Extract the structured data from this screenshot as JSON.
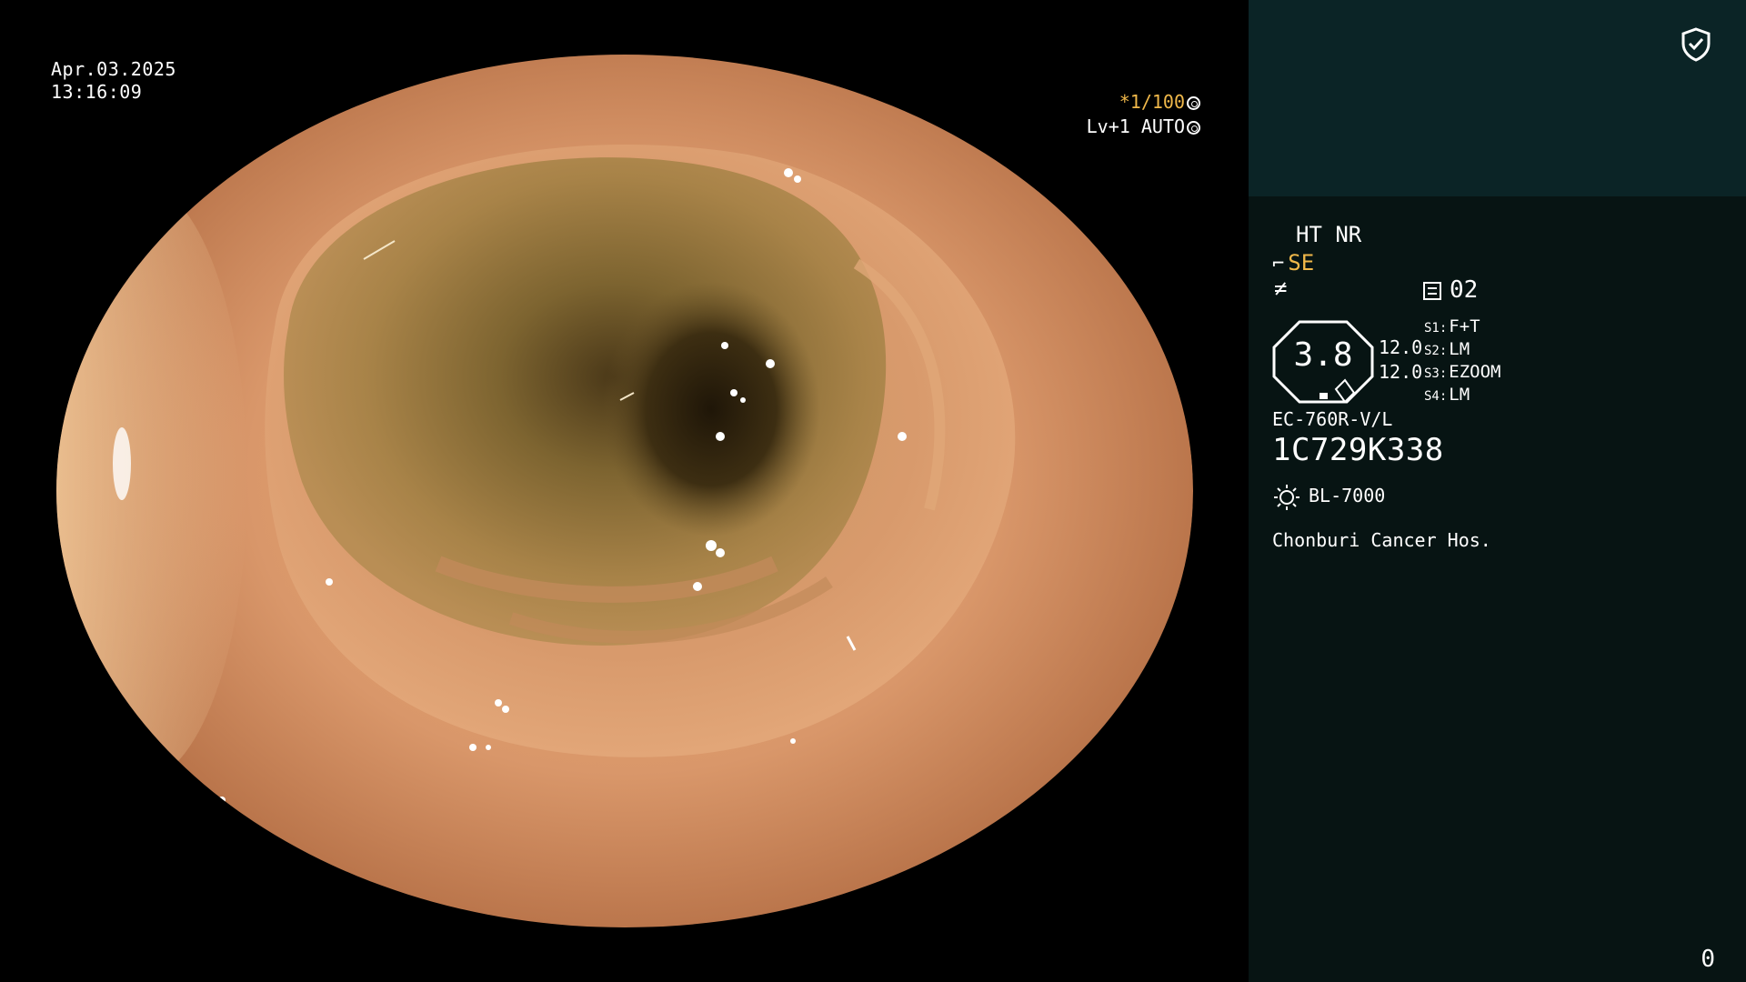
{
  "overlay": {
    "date": "Apr.03.2025",
    "time": "13:16:09",
    "shutter": "*1/100",
    "level_mode": "Lv+1 AUTO"
  },
  "panel": {
    "mode_line": "HT NR",
    "enhance": "SE",
    "memory_number": "02",
    "gauge_value": "3.8",
    "value_top": "12.0",
    "value_bottom": "12.0",
    "switches": [
      {
        "key": "S1:",
        "value": "F+T"
      },
      {
        "key": "S2:",
        "value": "LM"
      },
      {
        "key": "S3:",
        "value": "EZOOM"
      },
      {
        "key": "S4:",
        "value": "LM"
      }
    ],
    "scope_model": "EC-760R-V/L",
    "scope_serial": "1C729K338",
    "light_source": "BL-7000",
    "hospital": "Chonburi Cancer Hos.",
    "counter": "0"
  },
  "colors": {
    "accent_orange": "#f0b84a",
    "panel_top": "#0b2426",
    "panel_body": "#071413",
    "mucosa": "#d9976a"
  },
  "icons": [
    "shield-check-icon",
    "aperture-icon",
    "auto-circle-icon",
    "hook-icon",
    "slash-icon",
    "memory-doc-icon",
    "octagon-gauge-icon",
    "light-source-icon"
  ]
}
